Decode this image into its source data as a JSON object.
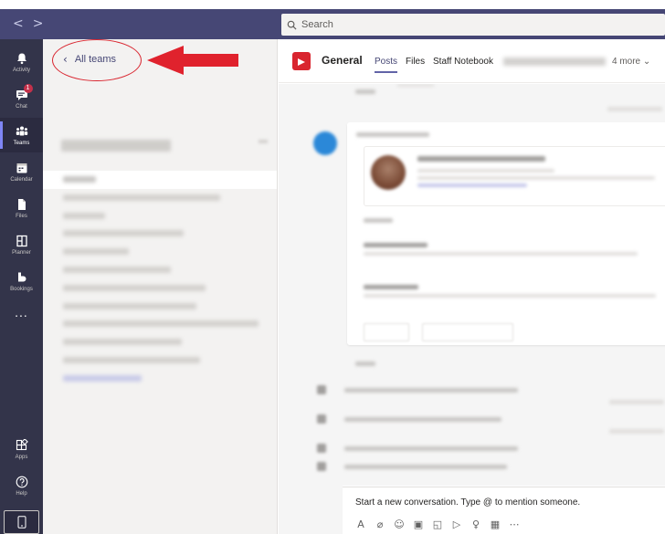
{
  "window": {
    "nav_back": "<",
    "nav_forward": ">"
  },
  "search": {
    "placeholder": "Search"
  },
  "rail": {
    "items": [
      {
        "label": "Activity",
        "icon": "bell-icon"
      },
      {
        "label": "Chat",
        "icon": "chat-icon",
        "badge": "1"
      },
      {
        "label": "Teams",
        "icon": "teams-icon",
        "active": true
      },
      {
        "label": "Calendar",
        "icon": "calendar-icon"
      },
      {
        "label": "Files",
        "icon": "files-icon"
      },
      {
        "label": "Planner",
        "icon": "planner-icon"
      },
      {
        "label": "Bookings",
        "icon": "bookings-icon"
      }
    ],
    "more": "...",
    "bottom": [
      {
        "label": "Apps",
        "icon": "apps-icon"
      },
      {
        "label": "Help",
        "icon": "help-icon"
      }
    ]
  },
  "teams_panel": {
    "back_label": "All teams",
    "channel_count": 11
  },
  "channel": {
    "title": "General",
    "tabs": [
      "Posts",
      "Files",
      "Staff Notebook"
    ],
    "more_tabs": "4 more"
  },
  "compose": {
    "placeholder": "Start a new conversation. Type @ to mention someone."
  },
  "colors": {
    "rail_bg": "#33344a",
    "titlebar_bg": "#464775",
    "accent": "#6264a7",
    "annotation_red": "#d9252f"
  }
}
